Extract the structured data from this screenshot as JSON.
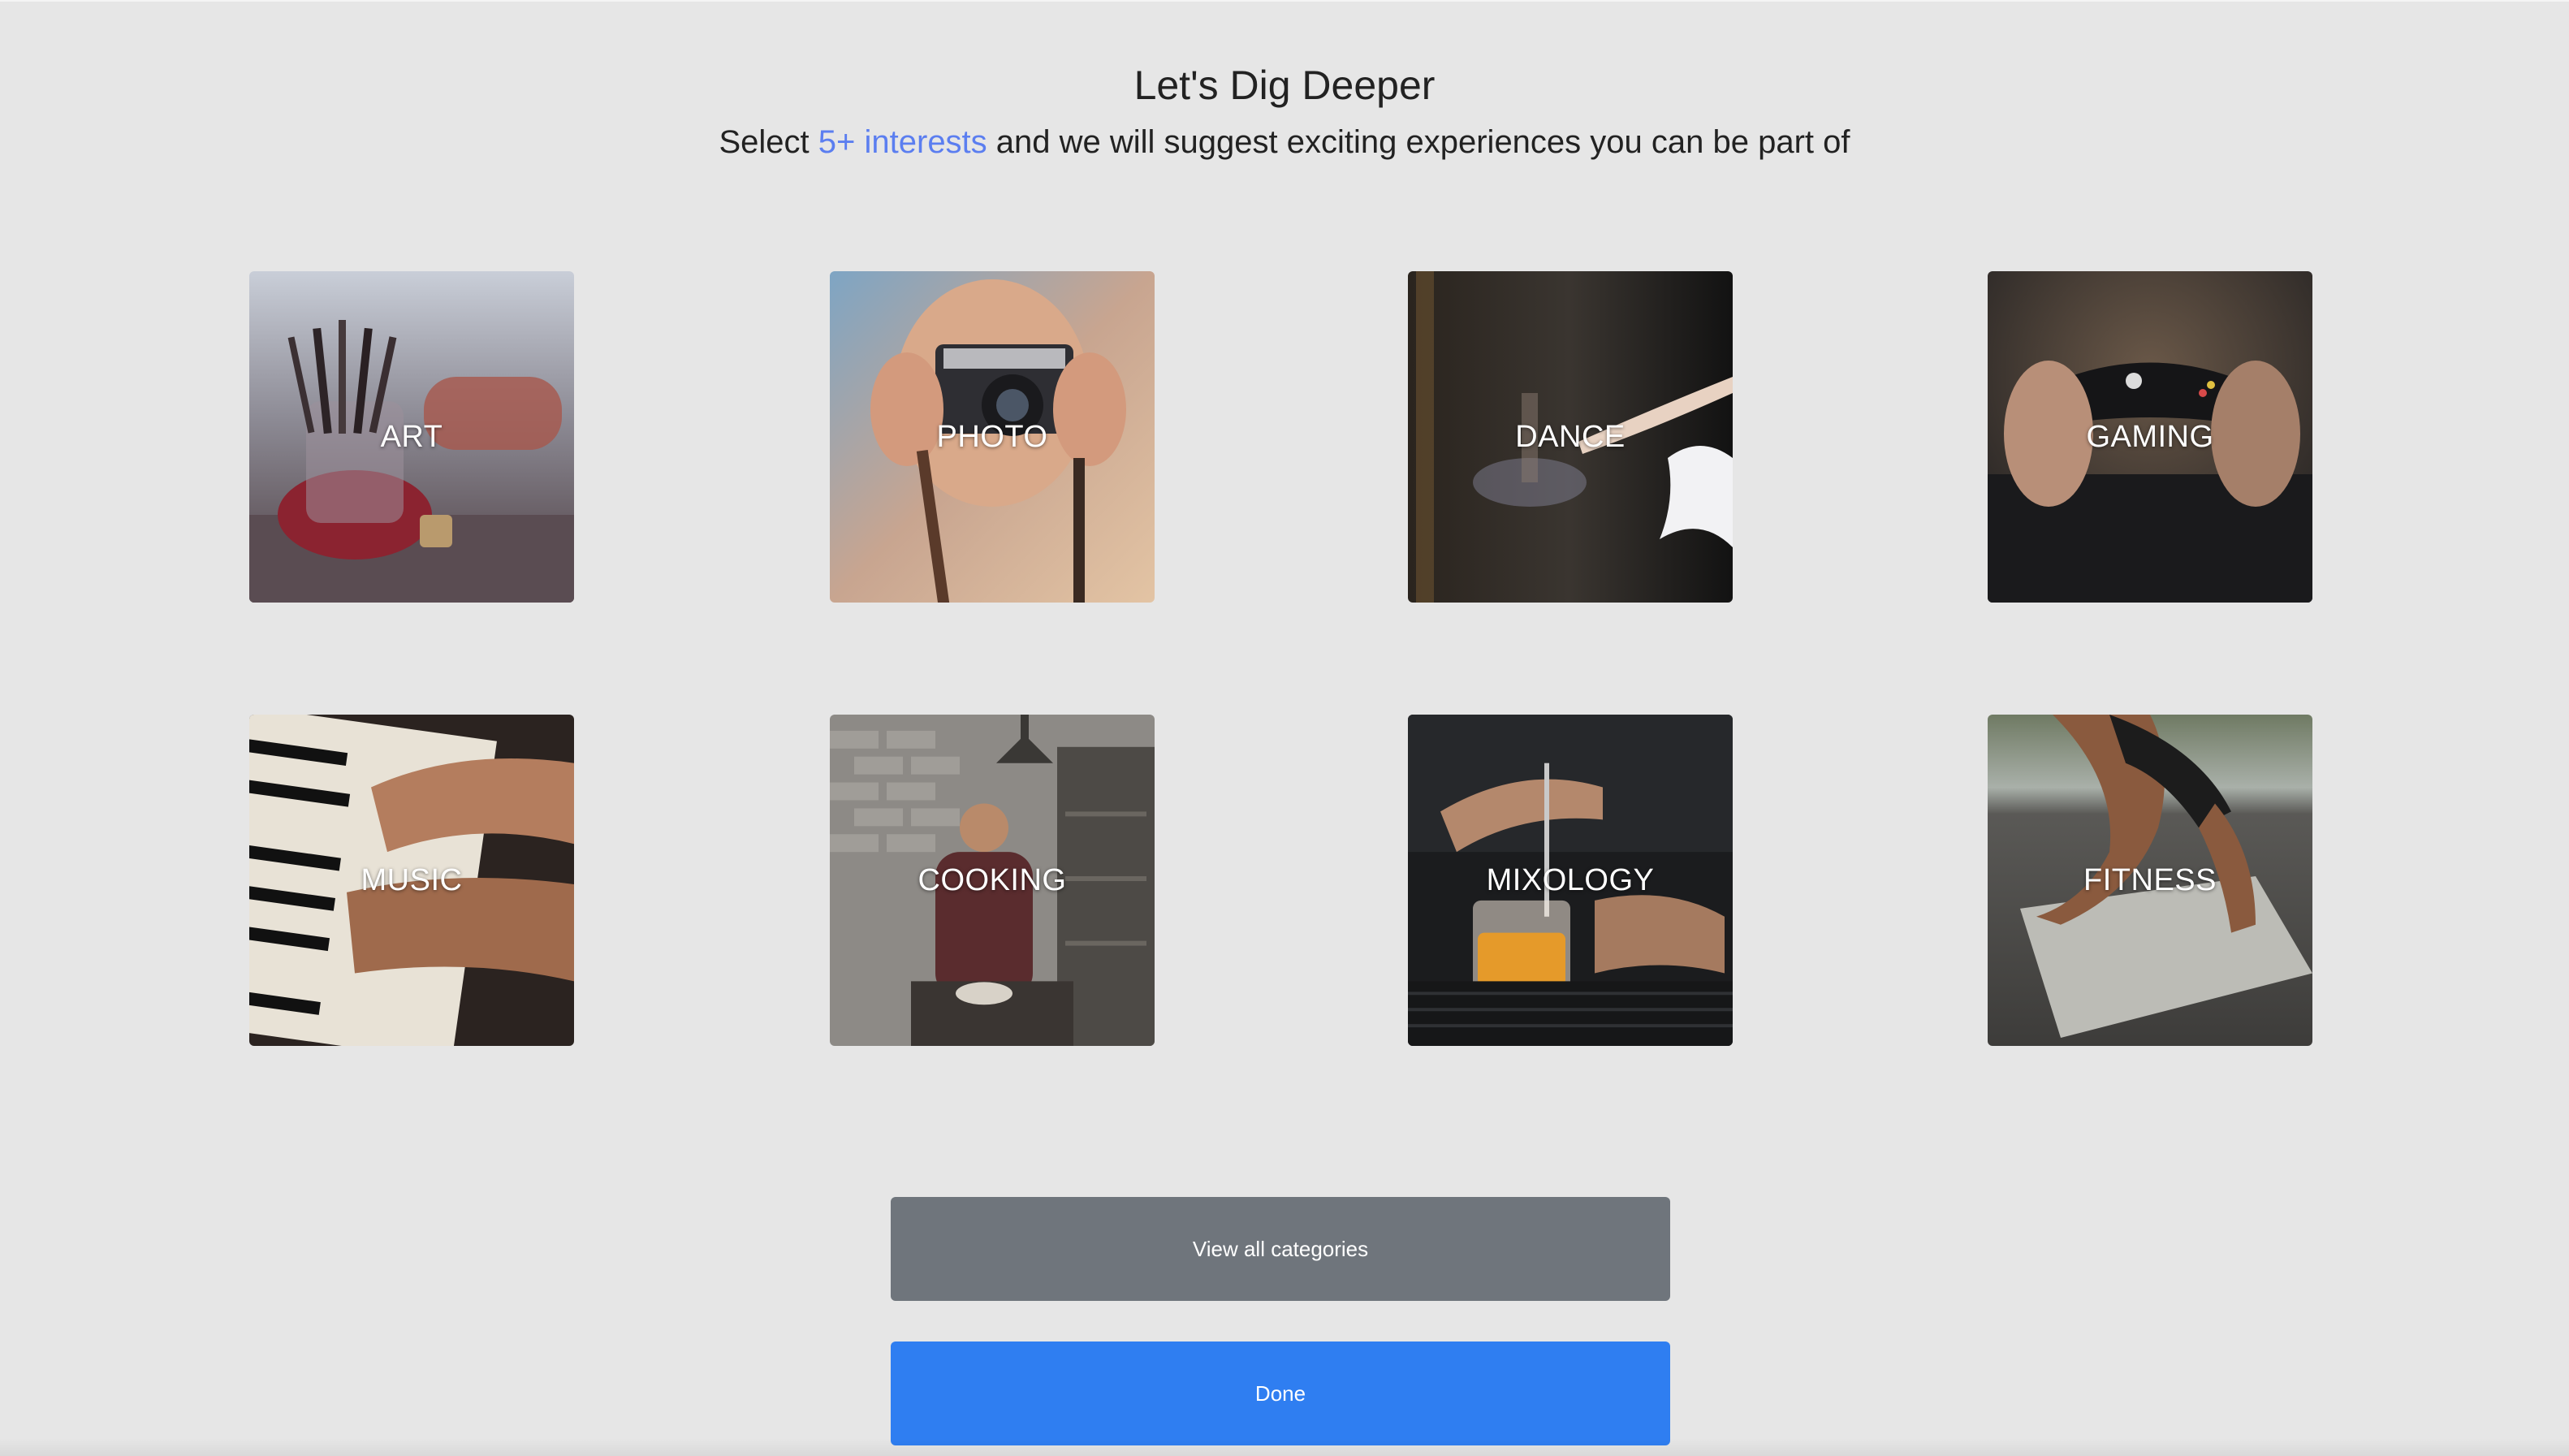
{
  "header": {
    "title": "Let's Dig Deeper",
    "subtitle_prefix": "Select ",
    "subtitle_accent": "5+ interests",
    "subtitle_suffix": " and we will suggest exciting experiences you can be part of"
  },
  "categories": [
    {
      "label": "ART"
    },
    {
      "label": "PHOTO"
    },
    {
      "label": "DANCE"
    },
    {
      "label": "GAMING"
    },
    {
      "label": "MUSIC"
    },
    {
      "label": "COOKING"
    },
    {
      "label": "MIXOLOGY"
    },
    {
      "label": "FITNESS"
    }
  ],
  "actions": {
    "view_all_label": "View all categories",
    "done_label": "Done"
  },
  "colors": {
    "background": "#e6e6e6",
    "accent": "#5b7ef0",
    "secondary_button": "#6f757c",
    "primary_button": "#2f7ef1"
  }
}
